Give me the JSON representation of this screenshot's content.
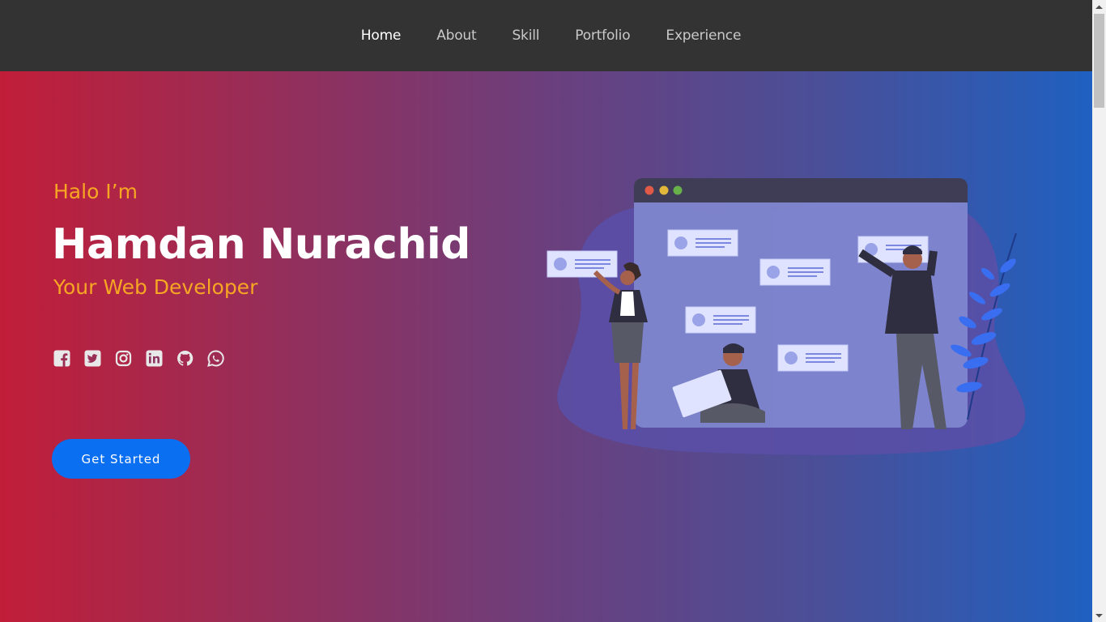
{
  "nav": {
    "items": [
      {
        "label": "Home",
        "active": true
      },
      {
        "label": "About"
      },
      {
        "label": "Skill"
      },
      {
        "label": "Portfolio"
      },
      {
        "label": "Experience"
      }
    ]
  },
  "hero": {
    "greeting": "Halo I’m",
    "name": "Hamdan Nurachid",
    "role": "Your Web Developer",
    "cta_label": "Get Started",
    "socials": [
      {
        "icon": "facebook-icon"
      },
      {
        "icon": "twitter-icon"
      },
      {
        "icon": "instagram-icon"
      },
      {
        "icon": "linkedin-icon"
      },
      {
        "icon": "github-icon"
      },
      {
        "icon": "whatsapp-icon"
      }
    ],
    "illustration": "team-collaboration-illustration"
  },
  "colors": {
    "navbar": "#333333",
    "accent": "#f6a623",
    "cta": "#0a6ff0",
    "gradient_start": "#c11e38",
    "gradient_end": "#1f60c0"
  }
}
